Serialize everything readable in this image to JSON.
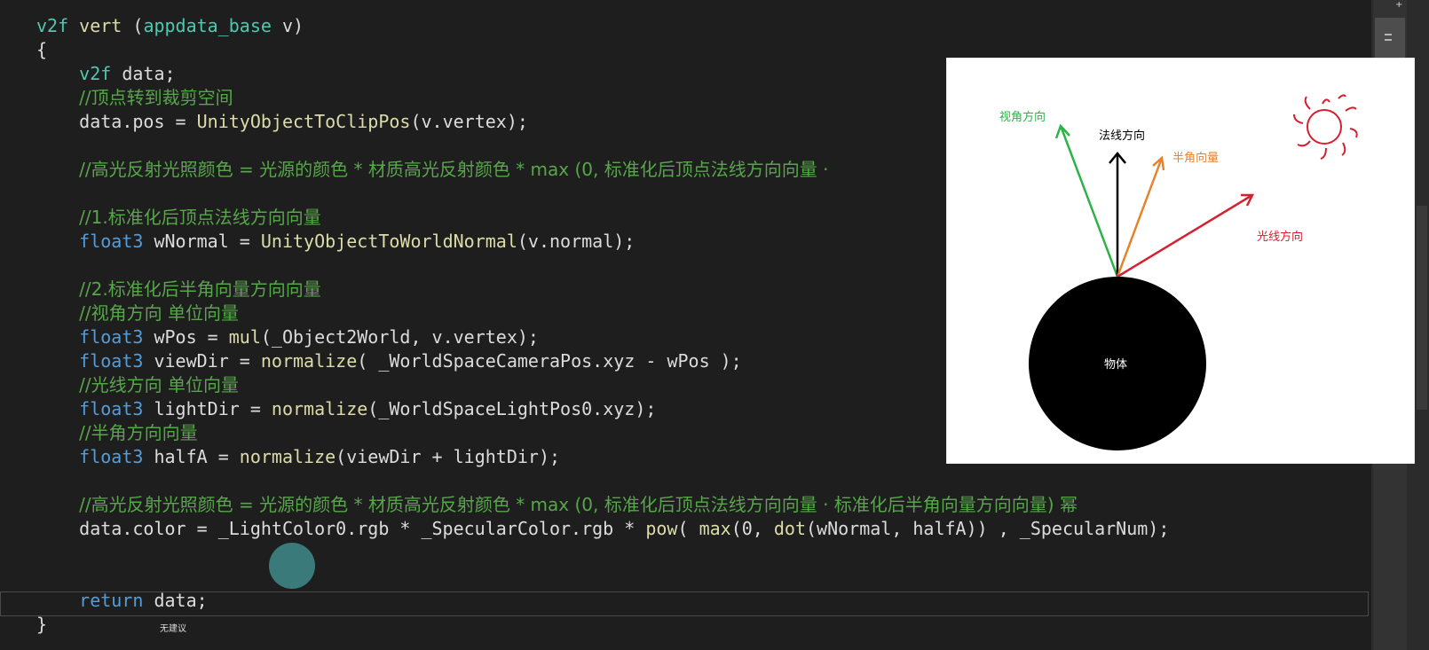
{
  "editor": {
    "lines": [
      {
        "id": "l1",
        "tokens": [
          {
            "c": "t-type",
            "t": "v2f"
          },
          {
            "c": "t-tx",
            "t": " "
          },
          {
            "c": "t-fn",
            "t": "vert"
          },
          {
            "c": "t-tx",
            "t": " ("
          },
          {
            "c": "t-type",
            "t": "appdata_base"
          },
          {
            "c": "t-tx",
            "t": " v)"
          }
        ]
      },
      {
        "id": "l2",
        "tokens": [
          {
            "c": "t-tx",
            "t": "{"
          }
        ]
      },
      {
        "id": "l3",
        "tokens": [
          {
            "c": "t-tx",
            "t": "    "
          },
          {
            "c": "t-type",
            "t": "v2f"
          },
          {
            "c": "t-tx",
            "t": " data;"
          }
        ]
      },
      {
        "id": "l4",
        "tokens": [
          {
            "c": "t-tx",
            "t": "    "
          },
          {
            "c": "t-cmz",
            "t": "//顶点转到裁剪空间"
          }
        ]
      },
      {
        "id": "l5",
        "tokens": [
          {
            "c": "t-tx",
            "t": "    data.pos = "
          },
          {
            "c": "t-fn",
            "t": "UnityObjectToClipPos"
          },
          {
            "c": "t-tx",
            "t": "(v.vertex);"
          }
        ]
      },
      {
        "id": "l6",
        "tokens": []
      },
      {
        "id": "l7",
        "tokens": [
          {
            "c": "t-tx",
            "t": "    "
          },
          {
            "c": "t-cmz",
            "t": "//高光反射光照颜色 = 光源的颜色 * 材质高光反射颜色 * max (0, 标准化后顶点法线方向向量 ·"
          }
        ]
      },
      {
        "id": "l8",
        "tokens": []
      },
      {
        "id": "l9",
        "tokens": [
          {
            "c": "t-tx",
            "t": "    "
          },
          {
            "c": "t-cmz",
            "t": "//1.标准化后顶点法线方向向量"
          }
        ]
      },
      {
        "id": "l10",
        "tokens": [
          {
            "c": "t-tx",
            "t": "    "
          },
          {
            "c": "t-kw",
            "t": "float3"
          },
          {
            "c": "t-tx",
            "t": " wNormal = "
          },
          {
            "c": "t-fn",
            "t": "UnityObjectToWorldNormal"
          },
          {
            "c": "t-tx",
            "t": "(v.normal);"
          }
        ]
      },
      {
        "id": "l11",
        "tokens": []
      },
      {
        "id": "l12",
        "tokens": [
          {
            "c": "t-tx",
            "t": "    "
          },
          {
            "c": "t-cmz",
            "t": "//2.标准化后半角向量方向向量"
          }
        ]
      },
      {
        "id": "l13",
        "tokens": [
          {
            "c": "t-tx",
            "t": "    "
          },
          {
            "c": "t-cmz",
            "t": "//视角方向 单位向量"
          }
        ]
      },
      {
        "id": "l14",
        "tokens": [
          {
            "c": "t-tx",
            "t": "    "
          },
          {
            "c": "t-kw",
            "t": "float3"
          },
          {
            "c": "t-tx",
            "t": " wPos = "
          },
          {
            "c": "t-fn",
            "t": "mul"
          },
          {
            "c": "t-tx",
            "t": "(_Object2World, v.vertex);"
          }
        ]
      },
      {
        "id": "l15",
        "tokens": [
          {
            "c": "t-tx",
            "t": "    "
          },
          {
            "c": "t-kw",
            "t": "float3"
          },
          {
            "c": "t-tx",
            "t": " viewDir = "
          },
          {
            "c": "t-fn",
            "t": "normalize"
          },
          {
            "c": "t-tx",
            "t": "( _WorldSpaceCameraPos.xyz - wPos );"
          }
        ]
      },
      {
        "id": "l16",
        "tokens": [
          {
            "c": "t-tx",
            "t": "    "
          },
          {
            "c": "t-cmz",
            "t": "//光线方向 单位向量"
          }
        ]
      },
      {
        "id": "l17",
        "tokens": [
          {
            "c": "t-tx",
            "t": "    "
          },
          {
            "c": "t-kw",
            "t": "float3"
          },
          {
            "c": "t-tx",
            "t": " lightDir = "
          },
          {
            "c": "t-fn",
            "t": "normalize"
          },
          {
            "c": "t-tx",
            "t": "(_WorldSpaceLightPos0.xyz);"
          }
        ]
      },
      {
        "id": "l18",
        "tokens": [
          {
            "c": "t-tx",
            "t": "    "
          },
          {
            "c": "t-cmz",
            "t": "//半角方向向量"
          }
        ]
      },
      {
        "id": "l19",
        "tokens": [
          {
            "c": "t-tx",
            "t": "    "
          },
          {
            "c": "t-kw",
            "t": "float3"
          },
          {
            "c": "t-tx",
            "t": " halfA = "
          },
          {
            "c": "t-fn",
            "t": "normalize"
          },
          {
            "c": "t-tx",
            "t": "(viewDir + lightDir);"
          }
        ]
      },
      {
        "id": "l20",
        "tokens": []
      },
      {
        "id": "l21",
        "tokens": [
          {
            "c": "t-tx",
            "t": "    "
          },
          {
            "c": "t-cmz",
            "t": "//高光反射光照颜色 = 光源的颜色 * 材质高光反射颜色 * max (0, 标准化后顶点法线方向向量 · 标准化后半角向量方向向量) 幂"
          }
        ]
      },
      {
        "id": "l22",
        "tokens": [
          {
            "c": "t-tx",
            "t": "    data.color = _LightColor0.rgb * _SpecularColor.rgb * "
          },
          {
            "c": "t-fn",
            "t": "pow"
          },
          {
            "c": "t-tx",
            "t": "( "
          },
          {
            "c": "t-fn",
            "t": "max"
          },
          {
            "c": "t-tx",
            "t": "(0, "
          },
          {
            "c": "t-fn",
            "t": "dot"
          },
          {
            "c": "t-tx",
            "t": "(wNormal, halfA)) , _SpecularNum);"
          }
        ]
      },
      {
        "id": "l23",
        "tokens": []
      },
      {
        "id": "l24",
        "tokens": []
      },
      {
        "id": "l25",
        "tokens": [
          {
            "c": "t-tx",
            "t": "    "
          },
          {
            "c": "t-kw",
            "t": "return"
          },
          {
            "c": "t-tx",
            "t": " data;"
          }
        ]
      },
      {
        "id": "l26",
        "tokens": [
          {
            "c": "t-tx",
            "t": "}"
          }
        ]
      }
    ],
    "suggestion_text": "无建议"
  },
  "diagram": {
    "view_dir_label": "视角方向",
    "normal_label": "法线方向",
    "half_label": "半角向量",
    "light_label": "光线方向",
    "object_label": "物体",
    "colors": {
      "view": "#2db34a",
      "normal": "#000000",
      "half": "#e8822a",
      "light": "#d42030",
      "sun": "#d42030"
    }
  },
  "top_glyph": "+"
}
